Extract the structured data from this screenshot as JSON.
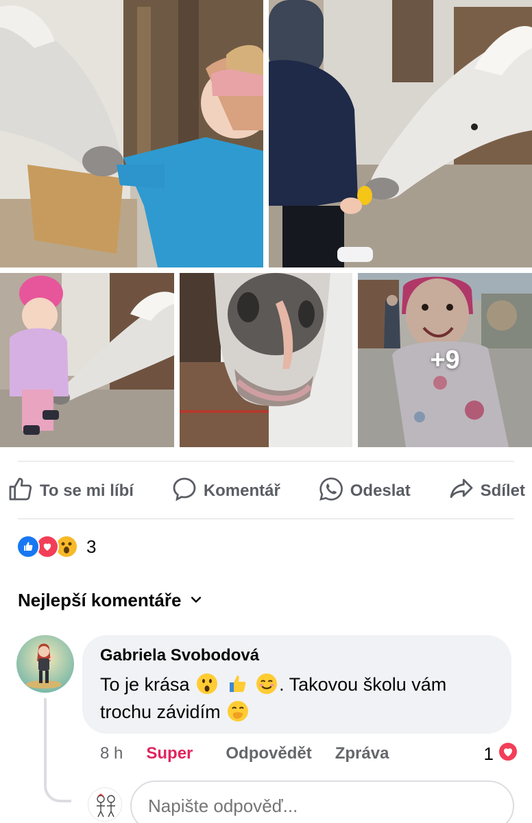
{
  "photos": {
    "more_count": "+9"
  },
  "actions": {
    "like": "To se mi líbí",
    "comment": "Komentář",
    "send": "Odeslat",
    "share": "Sdílet"
  },
  "reactions": {
    "types": [
      "like",
      "love",
      "wow"
    ],
    "count": "3"
  },
  "comments_filter": {
    "label": "Nejlepší komentáře"
  },
  "comment": {
    "author": "Gabriela Svobodová",
    "text_part1": "To je krása",
    "text_part2": ". Takovou školu vám trochu závidím",
    "emojis": [
      "astonished-face",
      "thumbs-up",
      "smiling-face",
      "face-with-hand-over-mouth"
    ],
    "time": "8 h",
    "reaction_label": "Super",
    "reply": "Odpovědět",
    "message": "Zpráva",
    "likes": "1"
  },
  "reply_box": {
    "placeholder": "Napište odpověď..."
  },
  "colors": {
    "accent_red": "#e0245e",
    "like_blue": "#1877f2",
    "love_red": "#f33e58",
    "wow_yellow": "#f7b928"
  }
}
